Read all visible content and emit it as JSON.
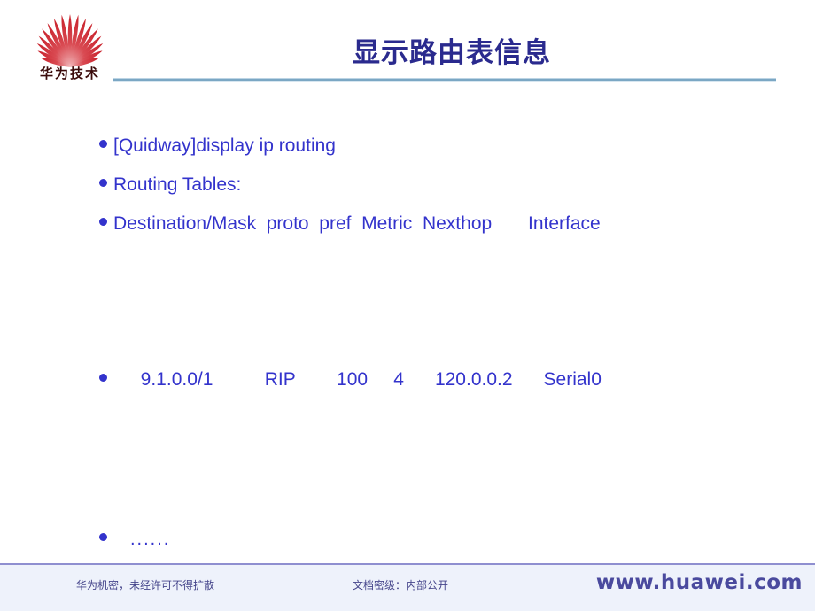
{
  "header": {
    "logo": {
      "icon": "huawei-fan-logo",
      "wordmark": "华为技术",
      "petal_color": "#c8202a",
      "petal_color_light": "#e8737a"
    },
    "title": "显示路由表信息",
    "title_color": "#2a2a8e",
    "rule_color": "#7ba7c4"
  },
  "body": {
    "text_color": "#3333cc",
    "bullets": [
      {
        "id": "command",
        "text": "[Quidway]display ip routing"
      },
      {
        "id": "tables",
        "text": "Routing Tables:"
      },
      {
        "id": "columns",
        "text": "Destination/Mask  proto  pref  Metric  Nexthop       Interface"
      },
      {
        "id": "route-row",
        "text": "  9.1.0.0/1          RIP        100     4      120.0.0.2      Serial0"
      },
      {
        "id": "more",
        "text": "......"
      }
    ],
    "route_table": {
      "headers": [
        "Destination/Mask",
        "proto",
        "pref",
        "Metric",
        "Nexthop",
        "Interface"
      ],
      "rows": [
        [
          "9.1.0.0/1",
          "RIP",
          "100",
          "4",
          "120.0.0.2",
          "Serial0"
        ]
      ],
      "continuation": "......"
    }
  },
  "footer": {
    "confidential_notice": "华为机密，未经许可不得扩散",
    "classification": "文档密级：内部公开",
    "url": "www.huawei.com",
    "text_color": "#46468c",
    "band_color": "#eef2fb",
    "rule_color": "#8f8fd0"
  }
}
